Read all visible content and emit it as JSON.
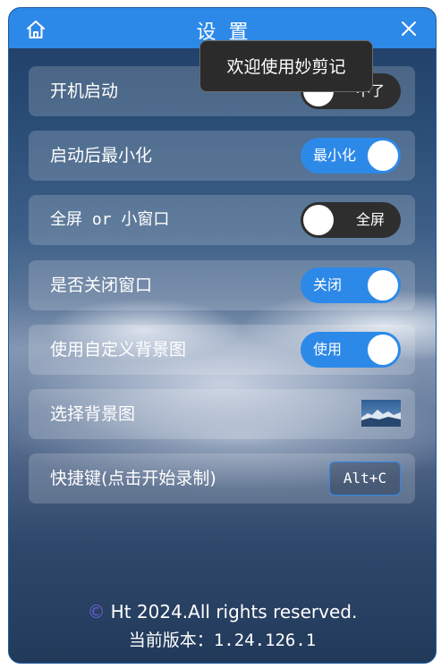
{
  "window": {
    "title": "设置"
  },
  "tooltip": {
    "text": "欢迎使用妙剪记"
  },
  "settings": {
    "rows": [
      {
        "label": "开机启动",
        "toggle_text": "不了",
        "state": "off"
      },
      {
        "label": "启动后最小化",
        "toggle_text": "最小化",
        "state": "on"
      },
      {
        "label": "全屏 or 小窗口",
        "toggle_text": "全屏",
        "state": "off"
      },
      {
        "label": "是否关闭窗口",
        "toggle_text": "关闭",
        "state": "on"
      },
      {
        "label": "使用自定义背景图",
        "toggle_text": "使用",
        "state": "on"
      },
      {
        "label": "选择背景图"
      },
      {
        "label": "快捷键(点击开始录制)",
        "shortcut": "Alt+C"
      }
    ]
  },
  "footer": {
    "copyright_symbol": "©",
    "copyright": "Ht 2024.All rights reserved.",
    "version_label": "当前版本：",
    "version": "1.24.126.1"
  },
  "colors": {
    "accent": "#2d89e8",
    "toggle_off": "#2e2e2e",
    "tooltip_bg": "#2b2b2b"
  },
  "icons": {
    "home": "home-icon",
    "close": "close-icon",
    "thumbnail": "background-thumbnail"
  }
}
